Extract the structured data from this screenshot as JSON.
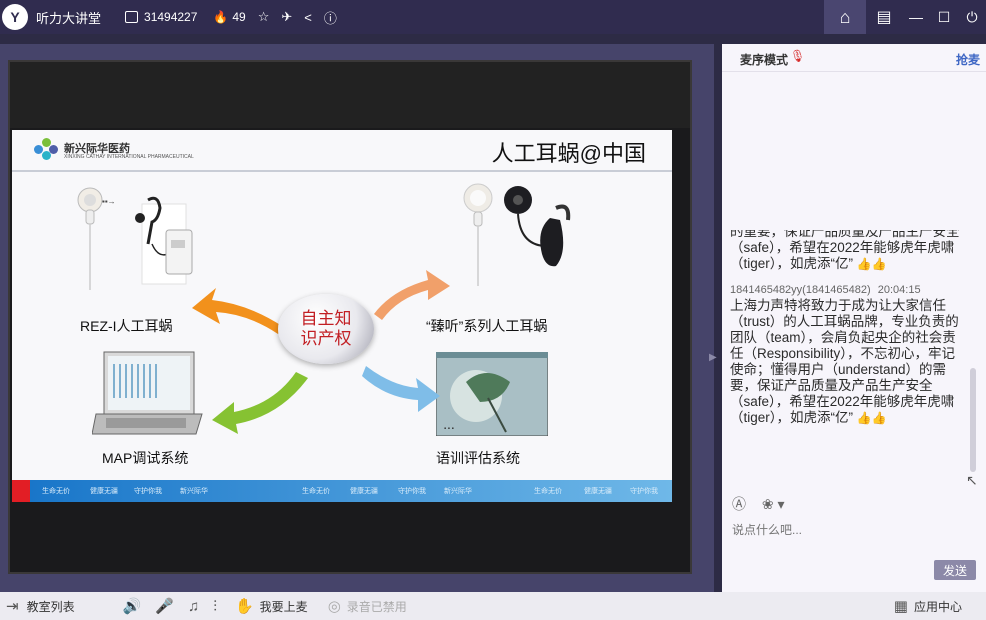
{
  "titlebar": {
    "app_title": "听力大讲堂",
    "room_id": "31494227",
    "fans_count": "49"
  },
  "slide": {
    "brand_name": "新兴际华医药",
    "brand_sub": "XINXING CATHAY INTERNATIONAL PHARMACEUTICAL",
    "title": "人工耳蜗@中国",
    "center_text": "自主知识产权",
    "products": {
      "rez": "REZ-I人工耳蜗",
      "zhenting": "“臻听”系列人工耳蜗",
      "map": "MAP调试系统",
      "training": "语训评估系统"
    },
    "footer_texts": [
      "生命无价",
      "健康无疆",
      "守护你我",
      "新兴际华",
      "生命无价",
      "健康无疆",
      "守护你我",
      "新兴际华",
      "生命无价",
      "健康无疆",
      "守护你我"
    ]
  },
  "right_panel": {
    "mode_label": "麦序模式",
    "grab_mic": "抢麦",
    "chat_old_partial": "的重要，保证产品质量及产品生产安全（safe），希望在2022年能够虎年虎啸（tiger），如虎添“亿”",
    "sender": "1841465482yy(1841465482)",
    "sender_time": "20:04:15",
    "chat_message": "上海力声特将致力于成为让大家信任（trust）的人工耳蜗品牌，专业负责的团队（team），会肩负起央企的社会责任（Responsibility），不忘初心，牢记使命；懂得用户（understand）的需要，保证产品质量及产品生产安全（safe），希望在2022年能够虎年虎啸（tiger），如虎添“亿”",
    "input_placeholder": "说点什么吧...",
    "send_label": "发送"
  },
  "bottombar": {
    "class_list": "教室列表",
    "want_mic": "我要上麦",
    "recording_disabled": "录音已禁用",
    "app_center": "应用中心"
  },
  "colors": {
    "titlebar_bg": "#302c4f",
    "stage_bg": "#46446a",
    "center_text": "#c21f24",
    "arrow_orange": "#f2911c",
    "arrow_green": "#86c232",
    "arrow_blue": "#7fbde8",
    "link_blue": "#3e66c4"
  }
}
